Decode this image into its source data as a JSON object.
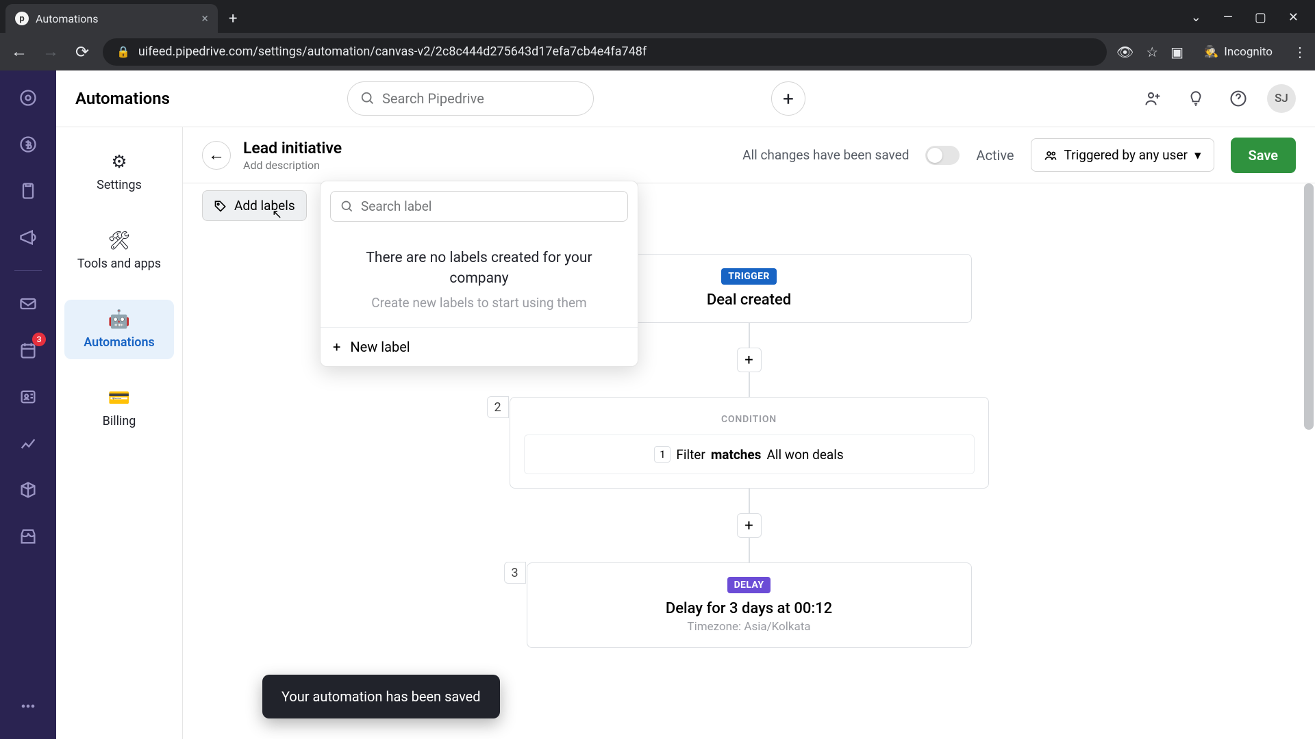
{
  "browser": {
    "tab_title": "Automations",
    "url": "uifeed.pipedrive.com/settings/automation/canvas-v2/2c8c444d275643d17efa7cb4e4fa748f",
    "incognito_label": "Incognito"
  },
  "topbar": {
    "title": "Automations",
    "search_placeholder": "Search Pipedrive",
    "avatar_initials": "SJ"
  },
  "rail": {
    "badge_count": "3"
  },
  "subsidebar": {
    "items": [
      {
        "label": "Settings"
      },
      {
        "label": "Tools and apps"
      },
      {
        "label": "Automations"
      },
      {
        "label": "Billing"
      }
    ]
  },
  "canvas_header": {
    "title": "Lead initiative",
    "description_placeholder": "Add description",
    "saved_text": "All changes have been saved",
    "active_label": "Active",
    "trigger_label": "Triggered by any user",
    "save_label": "Save"
  },
  "labels": {
    "add_labels_btn": "Add labels",
    "search_placeholder": "Search label",
    "empty_msg": "There are no labels created for your company",
    "empty_sub": "Create new labels to start using them",
    "new_label": "New label"
  },
  "flow": {
    "trigger": {
      "badge": "TRIGGER",
      "title": "Deal created"
    },
    "condition": {
      "num": "2",
      "badge": "CONDITION",
      "chip": "1",
      "filter_word": "Filter",
      "match_word": "matches",
      "value": "All won deals"
    },
    "delay": {
      "num": "3",
      "badge": "DELAY",
      "title": "Delay for 3 days at 00:12",
      "timezone": "Timezone: Asia/Kolkata"
    }
  },
  "toast": "Your automation has been saved"
}
